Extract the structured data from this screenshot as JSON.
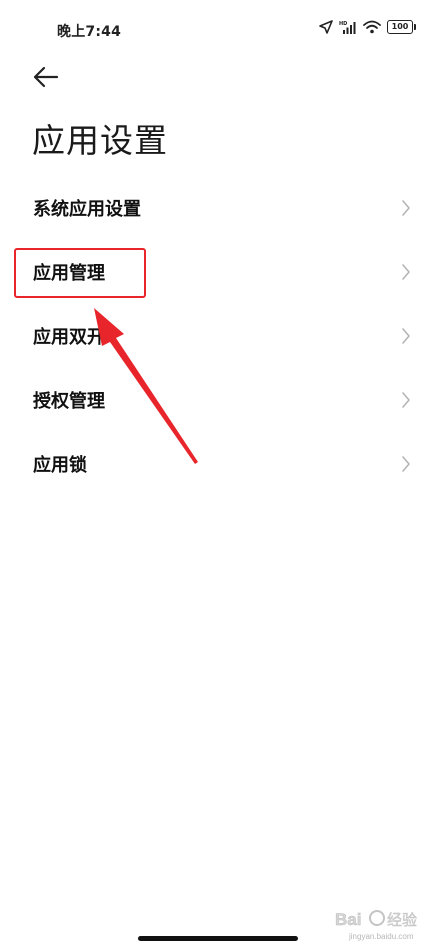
{
  "status_bar": {
    "time": "晚上7:44",
    "battery_level": "100",
    "icons": [
      "location-arrow-icon",
      "hd-signal-icon",
      "wifi-icon",
      "battery-icon"
    ]
  },
  "header": {
    "back_icon": "arrow-left-icon",
    "title": "应用设置"
  },
  "menu": {
    "items": [
      {
        "label": "系统应用设置",
        "icon": "chevron-right-icon"
      },
      {
        "label": "应用管理",
        "icon": "chevron-right-icon"
      },
      {
        "label": "应用双开",
        "icon": "chevron-right-icon"
      },
      {
        "label": "授权管理",
        "icon": "chevron-right-icon"
      },
      {
        "label": "应用锁",
        "icon": "chevron-right-icon"
      }
    ]
  },
  "annotation": {
    "color": "#e8252b",
    "highlighted_item": "应用管理"
  },
  "watermark": {
    "logo": "baidu-jingyan-logo",
    "text": "jingyan.baidu.com"
  }
}
